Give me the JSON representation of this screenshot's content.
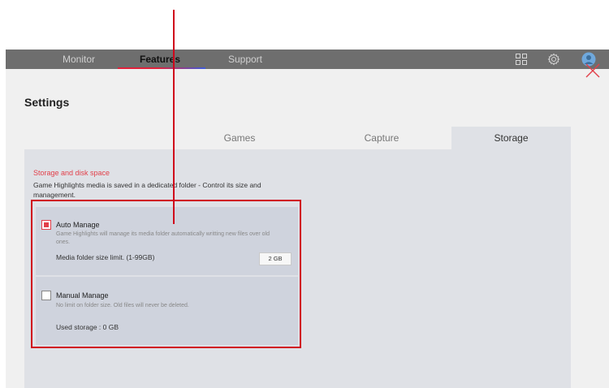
{
  "nav": {
    "tabs": [
      {
        "label": "Monitor",
        "active": false
      },
      {
        "label": "Features",
        "active": true
      },
      {
        "label": "Support",
        "active": false
      }
    ],
    "icons": [
      "grid-icon",
      "gear-icon",
      "avatar"
    ]
  },
  "header": {
    "title": "Settings"
  },
  "subtabs": [
    {
      "label": "Games",
      "active": false
    },
    {
      "label": "Capture",
      "active": false
    },
    {
      "label": "Storage",
      "active": true
    }
  ],
  "storage": {
    "section_title": "Storage and disk space",
    "section_desc": "Game Highlights media is saved in a dedicated folder - Control its size and management.",
    "auto": {
      "label": "Auto Manage",
      "checked": true,
      "desc": "Game Highlights will manage its media folder automatically writting new files over old ones.",
      "limit_label": "Media folder size limit. (1-99GB)",
      "limit_value": "2 GB"
    },
    "manual": {
      "label": "Manual Manage",
      "checked": false,
      "desc": "No limit on folder size. Old files will never be deleted.",
      "used_label": "Used storage : 0 GB"
    }
  },
  "colors": {
    "accent": "#e2404a",
    "highlight": "#d0021b",
    "nav_bg": "#6e6e6e"
  }
}
